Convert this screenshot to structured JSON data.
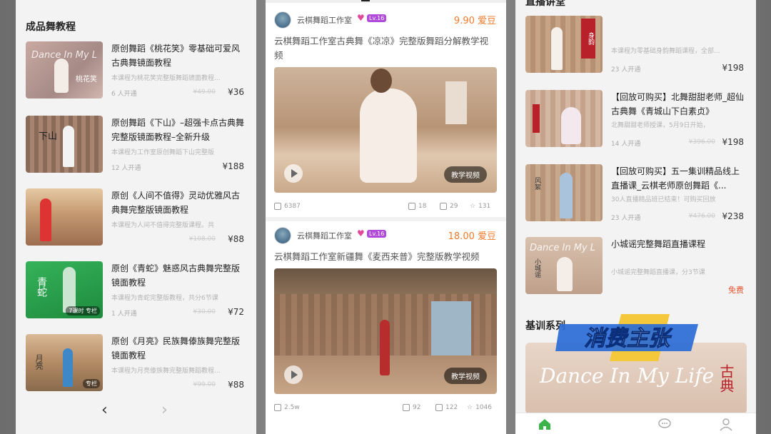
{
  "left": {
    "section_title": "成品舞教程",
    "courses": [
      {
        "title": "原创舞蹈《桃花笑》零基础可爱风古典舞镜面教程",
        "desc": "本课程为桃花笑完整版舞蹈镜面教程...",
        "enroll": "6 人开通",
        "orig": "¥49.00",
        "price": "¥36",
        "thumb_text": "桃花笑"
      },
      {
        "title": "原创舞蹈《下山》–超强卡点古典舞完整版镜面教程–全新升级",
        "desc": "本课程为工作室原创舞蹈下山完整版",
        "enroll": "12 人开通",
        "orig": "",
        "price": "¥188",
        "thumb_text": "下山"
      },
      {
        "title": "原创《人间不值得》灵动优雅风古典舞完整版镜面教程",
        "desc": "本课程为人间不值得完整版课程。共",
        "enroll": "",
        "orig": "¥108.00",
        "price": "¥88",
        "thumb_text": ""
      },
      {
        "title": "原创《青蛇》魅惑风古典舞完整版镜面教程",
        "desc": "本课程为青蛇完整版教程，共分6节课",
        "enroll": "1 人开通",
        "orig": "¥30.00",
        "price": "¥72",
        "thumb_text": "青蛇",
        "badge": "7课时 专栏"
      },
      {
        "title": "原创《月亮》民族舞傣族舞完整版镜面教程",
        "desc": "本课程为月亮傣族舞完整版舞蹈教程...",
        "enroll": "",
        "orig": "¥99.00",
        "price": "¥88",
        "thumb_text": "月亮",
        "badge": "专栏"
      }
    ],
    "pager_prev": "‹",
    "pager_next": "›"
  },
  "middle": {
    "posts": [
      {
        "author": "云棋舞蹈工作室",
        "lv": "Lv.16",
        "cost": "9.90 爱豆",
        "caption": "云棋舞蹈工作室古典舞《凉凉》完整版舞蹈分解教学视频",
        "tag": "教学视频",
        "views": "6387",
        "comments": "18",
        "likes": "29",
        "favs": "131"
      },
      {
        "author": "云棋舞蹈工作室",
        "lv": "Lv.16",
        "cost": "18.00 爱豆",
        "caption": "云棋舞蹈工作室新疆舞《麦西来普》完整版教学视频",
        "tag": "教学视频",
        "views": "2.5w",
        "comments": "92",
        "likes": "122",
        "favs": "1046"
      }
    ]
  },
  "right": {
    "section_top": "直播讲堂",
    "courses": [
      {
        "title": "",
        "desc": "本课程为零基础身韵舞蹈课程，全部...",
        "enroll": "23 人开通",
        "orig": "",
        "price": "¥198",
        "thumb_text": "身韵"
      },
      {
        "title": "【回放可购买】北舞甜甜老师_超仙古典舞《青城山下白素贞》",
        "desc": "北舞甜甜老师授课，5月9日开始，",
        "enroll": "14 人开通",
        "orig": "¥396.00",
        "price": "¥198",
        "thumb_text": ""
      },
      {
        "title": "【回放可购买】五一集训精品线上直播课_云棋老师原创舞蹈《...",
        "desc": "30人直播精品班已结束！可购买回放",
        "enroll": "23 人开通",
        "orig": "¥476.00",
        "price": "¥238",
        "thumb_text": ""
      },
      {
        "title": "小城谣完整舞蹈直播课程",
        "desc": "小城谣完整舞蹈直播课，分3节课",
        "enroll": "",
        "orig": "",
        "price": "免费",
        "thumb_text": "小城谣"
      }
    ],
    "section_bottom": "基训系列",
    "banner_text": "Dance In My Life",
    "banner_side": "古典"
  },
  "watermark": {
    "text": "消费主张"
  },
  "colors": {
    "accent": "#f07b2c",
    "free": "#e8532f",
    "nav_active": "#3bb54a",
    "lv": "#b04ad8"
  }
}
